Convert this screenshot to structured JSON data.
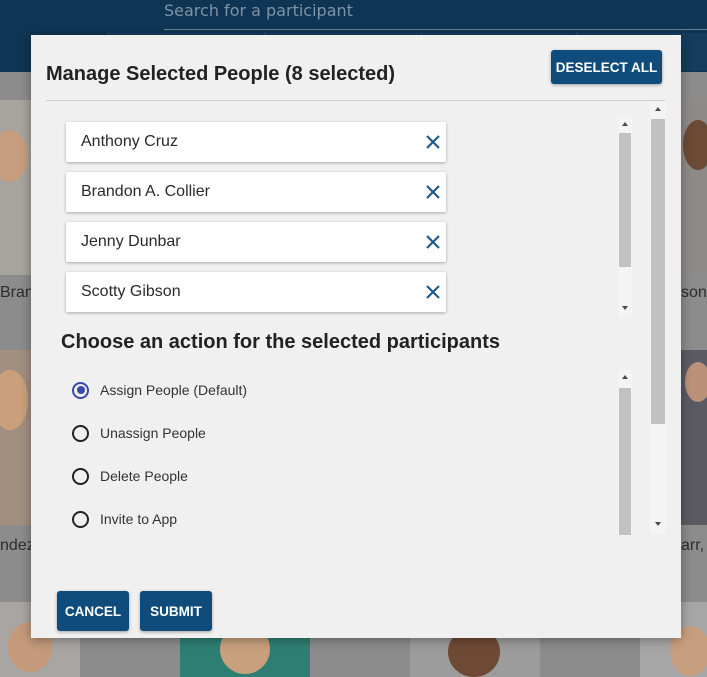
{
  "background": {
    "search_placeholder": "Search for a participant",
    "partial_names": [
      "Bran",
      "son,",
      "ndez",
      "arr, I"
    ]
  },
  "modal": {
    "title": "Manage Selected People (8 selected)",
    "deselect_all_label": "DESELECT ALL",
    "selected_people": [
      {
        "name": "Anthony Cruz",
        "remove_icon": "close-icon"
      },
      {
        "name": "Brandon A. Collier",
        "remove_icon": "close-icon"
      },
      {
        "name": "Jenny Dunbar",
        "remove_icon": "close-icon"
      },
      {
        "name": "Scotty Gibson",
        "remove_icon": "close-icon"
      }
    ],
    "action_heading": "Choose an action for the selected participants",
    "actions": [
      {
        "label": "Assign People (Default)",
        "checked": true
      },
      {
        "label": "Unassign People",
        "checked": false
      },
      {
        "label": "Delete People",
        "checked": false
      },
      {
        "label": "Invite to App",
        "checked": false
      }
    ],
    "cancel_label": "CANCEL",
    "submit_label": "SUBMIT"
  },
  "colors": {
    "primary_button": "#0f4c7c",
    "header": "#0e3554",
    "radio_selected": "#3949ab",
    "remove_icon": "#1f5a8a"
  }
}
